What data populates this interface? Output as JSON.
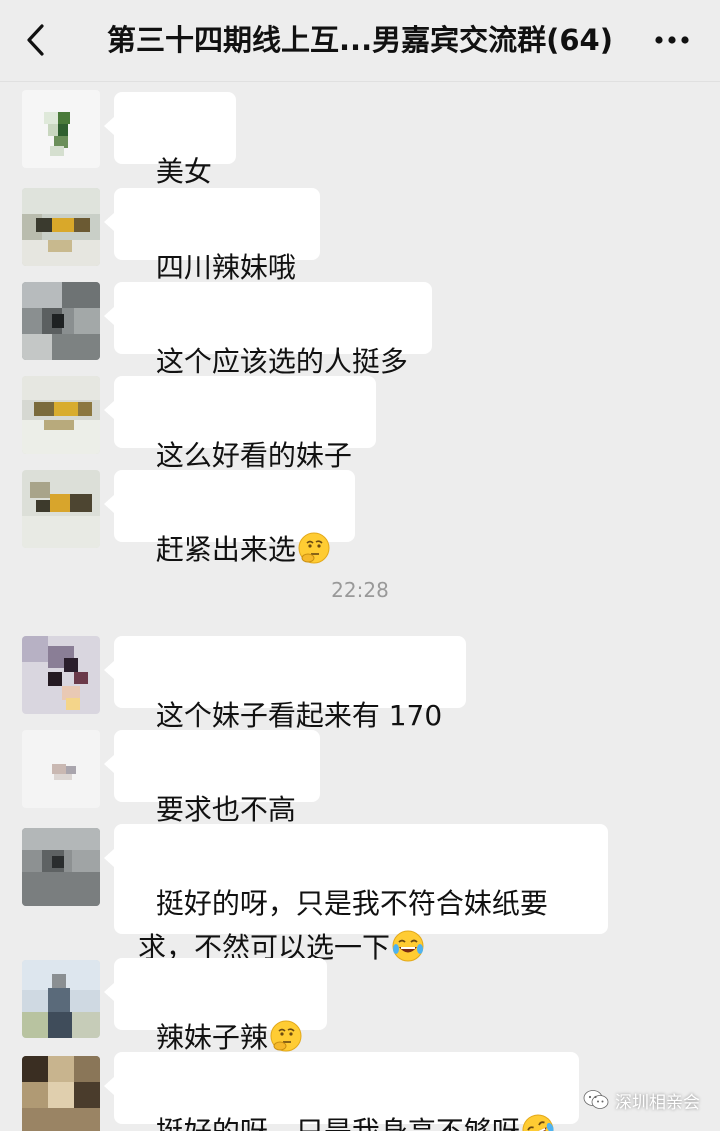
{
  "header": {
    "title": "第三十四期线上互...男嘉宾交流群(64)",
    "back_icon": "chevron-left-icon",
    "more_icon": "more-dots-icon"
  },
  "messages": [
    {
      "text": "美女",
      "emoji": ""
    },
    {
      "text": "四川辣妹哦",
      "emoji": ""
    },
    {
      "text": "这个应该选的人挺多",
      "emoji": ""
    },
    {
      "text": "这么好看的妹子",
      "emoji": ""
    },
    {
      "text": "赶紧出来选",
      "emoji": "thinking-face"
    },
    {
      "text": "这个妹子看起来有 170",
      "emoji": ""
    },
    {
      "text": "要求也不高",
      "emoji": ""
    },
    {
      "text": "挺好的呀，只是我不符合妹纸要\n求，不然可以选一下",
      "emoji": "tears-of-joy"
    },
    {
      "text": "辣妹子辣",
      "emoji": "thinking-face"
    },
    {
      "text": "挺好的呀，只是我身高不够呀",
      "emoji": "rolling-laughing"
    }
  ],
  "timestamp": "22:28",
  "watermark": {
    "text": "深圳相亲会",
    "icon": "wechat-icon"
  },
  "colors": {
    "background": "#ededed",
    "bubble": "#ffffff",
    "timestamp": "#999999"
  }
}
